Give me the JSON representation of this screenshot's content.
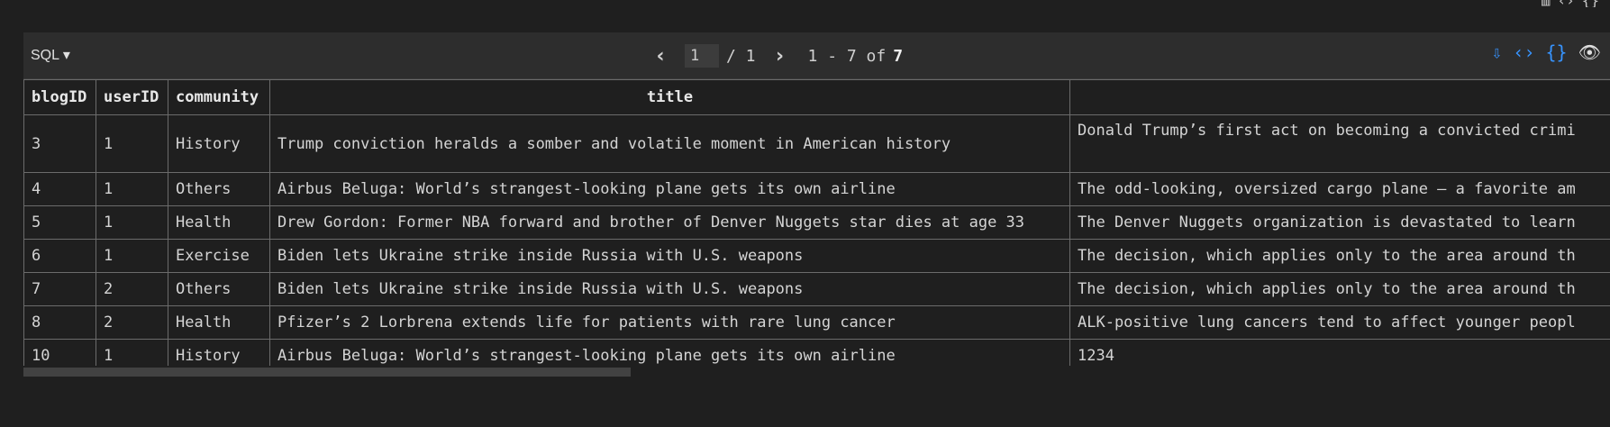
{
  "top_icons": [
    "table-icon",
    "code-icon",
    "braces-icon"
  ],
  "toolbar": {
    "language_label": "SQL",
    "dropdown_arrow": "▾",
    "prev_icon": "‹",
    "next_icon": "›",
    "page_value": "1",
    "page_total": "/ 1",
    "range_text": "1 - 7 of",
    "total_count": "7",
    "icons": {
      "export_table": "⇩",
      "export_code": "‹›",
      "export_json": "{}",
      "preview": "👁"
    }
  },
  "table": {
    "columns": [
      "blogID",
      "userID",
      "community",
      "title",
      ""
    ],
    "rows": [
      {
        "blogID": "3",
        "userID": "1",
        "community": "History",
        "title": "Trump conviction heralds a somber and volatile moment in American history",
        "content": "Donald Trump’s first act on becoming a convicted crimi"
      },
      {
        "blogID": "4",
        "userID": "1",
        "community": "Others",
        "title": "Airbus Beluga: World’s strangest-looking plane gets its own airline",
        "content": "The odd-looking, oversized cargo plane — a favorite am"
      },
      {
        "blogID": "5",
        "userID": "1",
        "community": "Health",
        "title": "Drew Gordon: Former NBA forward and brother of Denver Nuggets star dies at age 33",
        "content": "The Denver Nuggets organization is devastated to learn"
      },
      {
        "blogID": "6",
        "userID": "1",
        "community": "Exercise",
        "title": "Biden lets Ukraine strike inside Russia with U.S. weapons",
        "content": "The decision, which applies only to the area around th"
      },
      {
        "blogID": "7",
        "userID": "2",
        "community": "Others",
        "title": "Biden lets Ukraine strike inside Russia with U.S. weapons",
        "content": "The decision, which applies only to the area around th"
      },
      {
        "blogID": "8",
        "userID": "2",
        "community": "Health",
        "title": "Pfizer’s 2 Lorbrena extends life for patients with rare lung cancer",
        "content": "ALK-positive lung cancers tend to affect younger peopl"
      },
      {
        "blogID": "10",
        "userID": "1",
        "community": "History",
        "title": "Airbus Beluga: World’s strangest-looking plane gets its own airline",
        "content": "1234"
      }
    ]
  },
  "colors": {
    "background": "#1f1f1f",
    "toolbar": "#2d2d2d",
    "accent": "#3794ff",
    "border": "#6b6b6b"
  }
}
